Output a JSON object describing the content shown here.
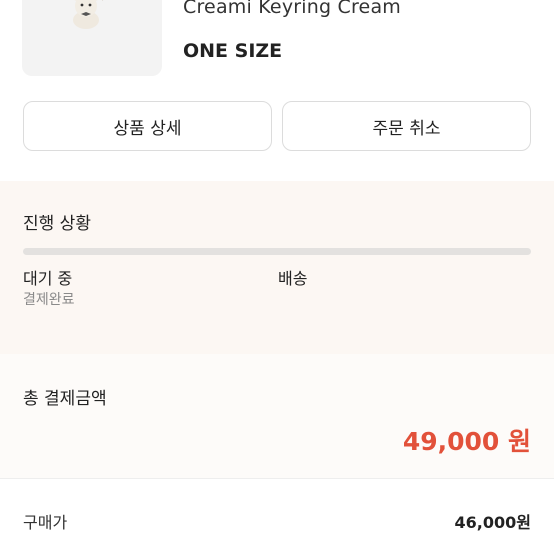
{
  "product": {
    "name": "Creami Keyring Cream",
    "size": "ONE SIZE",
    "image_icon": "plush-keyring-image"
  },
  "actions": {
    "detail_label": "상품 상세",
    "cancel_label": "주문 취소"
  },
  "progress": {
    "title": "진행 상황",
    "progress_fraction": 0,
    "stages": [
      {
        "label": "대기 중",
        "sub": "결제완료"
      },
      {
        "label": "배송"
      }
    ]
  },
  "payment": {
    "title": "총 결제금액",
    "total": "49,000 원",
    "rows": [
      {
        "label": "구매가",
        "value": "46,000원"
      }
    ]
  },
  "colors": {
    "accent": "#e2513a",
    "progress_bg": "#fcf7f3",
    "track": "#e3e1df"
  }
}
